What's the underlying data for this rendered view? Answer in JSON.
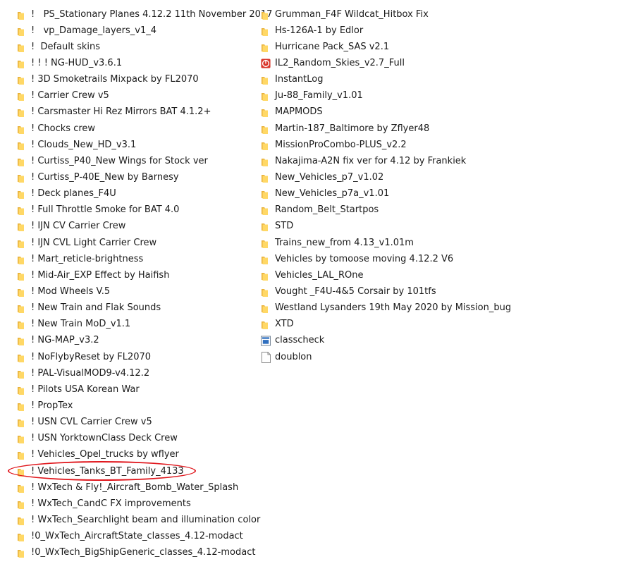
{
  "left_column": [
    {
      "label": "!   PS_Stationary Planes 4.12.2 11th November 2017",
      "icon": "folder-icon"
    },
    {
      "label": "!   vp_Damage_layers_v1_4",
      "icon": "folder-icon"
    },
    {
      "label": "!  Default skins",
      "icon": "folder-icon"
    },
    {
      "label": "! ! ! NG-HUD_v3.6.1",
      "icon": "folder-icon"
    },
    {
      "label": "! 3D Smoketrails Mixpack by FL2070",
      "icon": "folder-icon"
    },
    {
      "label": "! Carrier Crew v5",
      "icon": "folder-icon"
    },
    {
      "label": "! Carsmaster Hi Rez Mirrors BAT 4.1.2+",
      "icon": "folder-icon"
    },
    {
      "label": "! Chocks crew",
      "icon": "folder-icon"
    },
    {
      "label": "! Clouds_New_HD_v3.1",
      "icon": "folder-icon"
    },
    {
      "label": "! Curtiss_P40_New Wings for Stock ver",
      "icon": "folder-icon"
    },
    {
      "label": "! Curtiss_P-40E_New by Barnesy",
      "icon": "folder-icon"
    },
    {
      "label": "! Deck planes_F4U",
      "icon": "folder-icon"
    },
    {
      "label": "! Full Throttle Smoke for BAT 4.0",
      "icon": "folder-icon"
    },
    {
      "label": "! IJN CV Carrier Crew",
      "icon": "folder-icon"
    },
    {
      "label": "! IJN CVL Light Carrier Crew",
      "icon": "folder-icon"
    },
    {
      "label": "! Mart_reticle-brightness",
      "icon": "folder-icon"
    },
    {
      "label": "! Mid-Air_EXP Effect by Haifish",
      "icon": "folder-icon"
    },
    {
      "label": "! Mod Wheels V.5",
      "icon": "folder-icon"
    },
    {
      "label": "! New Train and Flak Sounds",
      "icon": "folder-icon"
    },
    {
      "label": "! New Train MoD_v1.1",
      "icon": "folder-icon"
    },
    {
      "label": "! NG-MAP_v3.2",
      "icon": "folder-icon"
    },
    {
      "label": "! NoFlybyReset by FL2070",
      "icon": "folder-icon"
    },
    {
      "label": "! PAL-VisualMOD9-v4.12.2",
      "icon": "folder-icon"
    },
    {
      "label": "! Pilots USA Korean War",
      "icon": "folder-icon"
    },
    {
      "label": "! PropTex",
      "icon": "folder-icon"
    },
    {
      "label": "! USN CVL Carrier Crew v5",
      "icon": "folder-icon"
    },
    {
      "label": "! USN YorktownClass Deck Crew",
      "icon": "folder-icon"
    },
    {
      "label": "! Vehicles_Opel_trucks by wflyer",
      "icon": "folder-icon"
    },
    {
      "label": "! Vehicles_Tanks_BT_Family_4133",
      "icon": "folder-icon"
    },
    {
      "label": "! WxTech & Fly!_Aircraft_Bomb_Water_Splash",
      "icon": "folder-icon"
    },
    {
      "label": "! WxTech_CandC FX improvements",
      "icon": "folder-icon"
    },
    {
      "label": "! WxTech_Searchlight beam and illumination color",
      "icon": "folder-icon"
    },
    {
      "label": "!0_WxTech_AircraftState_classes_4.12-modact",
      "icon": "folder-icon"
    },
    {
      "label": "!0_WxTech_BigShipGeneric_classes_4.12-modact",
      "icon": "folder-icon"
    }
  ],
  "right_column": [
    {
      "label": "Grumman_F4F Wildcat_Hitbox Fix",
      "icon": "folder-icon"
    },
    {
      "label": "Hs-126A-1 by Edlor",
      "icon": "folder-icon"
    },
    {
      "label": "Hurricane Pack_SAS v2.1",
      "icon": "folder-icon"
    },
    {
      "label": "IL2_Random_Skies_v2.7_Full",
      "icon": "app-shortcut-icon"
    },
    {
      "label": "InstantLog",
      "icon": "folder-icon"
    },
    {
      "label": "Ju-88_Family_v1.01",
      "icon": "folder-icon"
    },
    {
      "label": "MAPMODS",
      "icon": "folder-icon"
    },
    {
      "label": "Martin-187_Baltimore by Zflyer48",
      "icon": "folder-icon"
    },
    {
      "label": "MissionProCombo-PLUS_v2.2",
      "icon": "folder-icon"
    },
    {
      "label": "Nakajima-A2N fix ver for 4.12 by Frankiek",
      "icon": "folder-icon"
    },
    {
      "label": "New_Vehicles_p7_v1.02",
      "icon": "folder-icon"
    },
    {
      "label": "New_Vehicles_p7a_v1.01",
      "icon": "folder-icon"
    },
    {
      "label": "Random_Belt_Startpos",
      "icon": "folder-icon"
    },
    {
      "label": "STD",
      "icon": "folder-icon"
    },
    {
      "label": "Trains_new_from 4.13_v1.01m",
      "icon": "folder-icon"
    },
    {
      "label": "Vehicles by tomoose moving 4.12.2 V6",
      "icon": "folder-icon"
    },
    {
      "label": "Vehicles_LAL_ROne",
      "icon": "folder-icon"
    },
    {
      "label": "Vought _F4U-4&5 Corsair by 101tfs",
      "icon": "folder-icon"
    },
    {
      "label": "Westland Lysanders 19th May 2020 by Mission_bug",
      "icon": "folder-icon"
    },
    {
      "label": "XTD",
      "icon": "folder-icon"
    },
    {
      "label": "classcheck",
      "icon": "exe-window-icon"
    },
    {
      "label": "doublon",
      "icon": "text-document-icon"
    }
  ],
  "highlighted_item": "! Vehicles_Tanks_BT_Family_4133",
  "colors": {
    "folder_back": "#e8b13a",
    "folder_front": "#ffd866",
    "highlight_ellipse": "#e0161c",
    "app_icon_red": "#d9362a",
    "exe_blue": "#2f6fbf"
  }
}
